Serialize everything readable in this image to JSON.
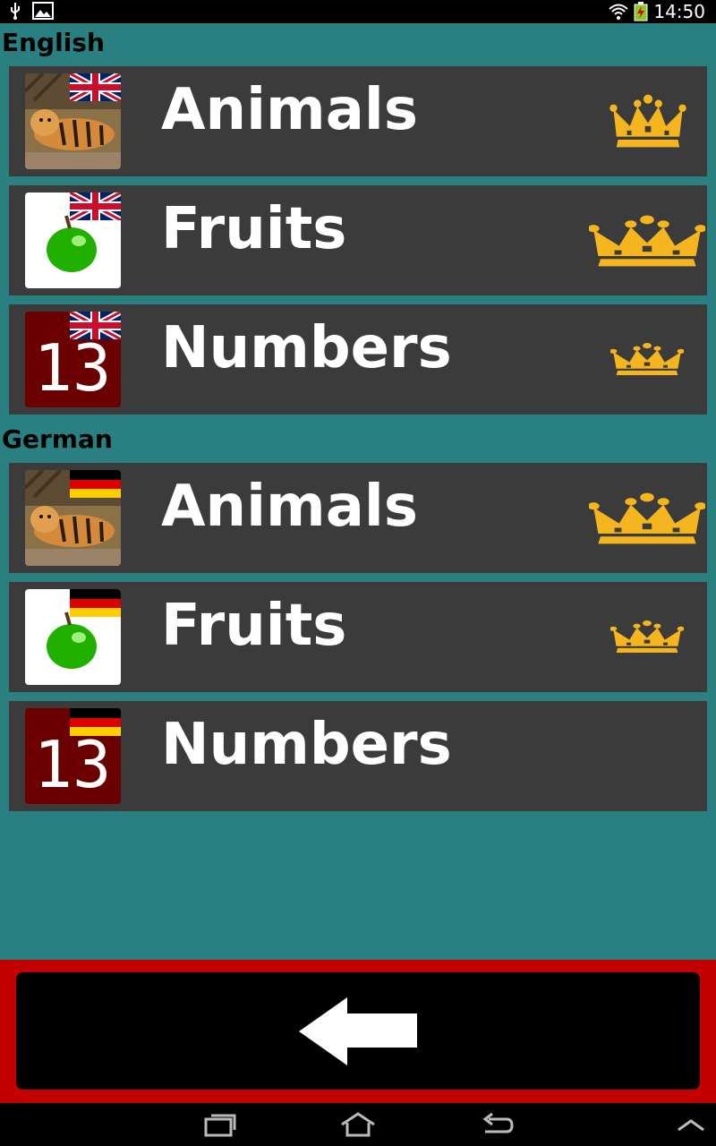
{
  "status_bar": {
    "time": "14:50"
  },
  "sections": [
    {
      "title": "English",
      "flag": "uk-flag-icon",
      "items": [
        {
          "label": "Animals",
          "thumb": "tiger",
          "crown": "crown-medium"
        },
        {
          "label": "Fruits",
          "thumb": "apple",
          "crown": "crown-large"
        },
        {
          "label": "Numbers",
          "thumb": "number",
          "crown": "crown-small"
        }
      ]
    },
    {
      "title": "German",
      "flag": "germany-flag-icon",
      "items": [
        {
          "label": "Animals",
          "thumb": "tiger",
          "crown": "crown-large"
        },
        {
          "label": "Fruits",
          "thumb": "apple",
          "crown": "crown-small"
        },
        {
          "label": "Numbers",
          "thumb": "number",
          "crown": "none"
        }
      ]
    }
  ],
  "thumb_number_text": "13",
  "colors": {
    "background": "#2a8080",
    "row": "#3b3b3b",
    "accent_red": "#c20000",
    "crown": "#f5b51e"
  }
}
